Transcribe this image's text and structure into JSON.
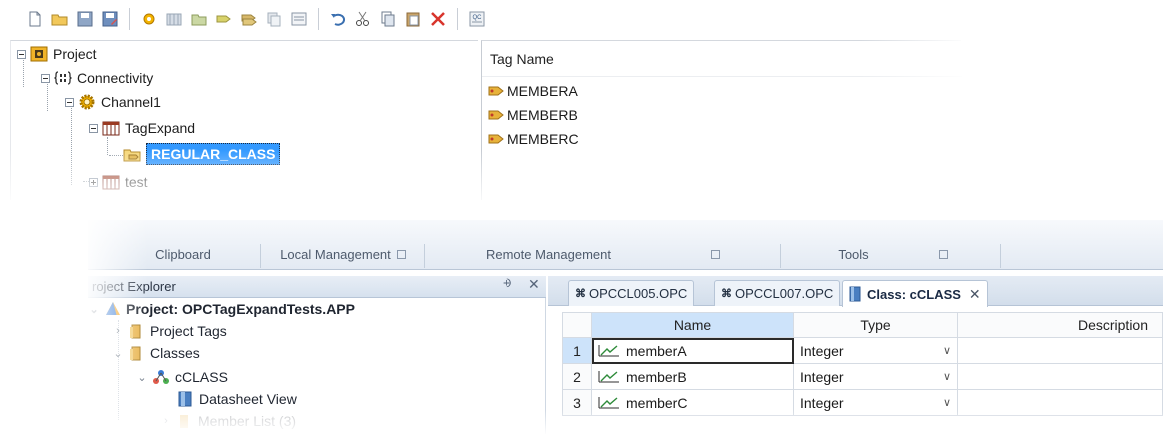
{
  "top": {
    "toolbar": {
      "icons": [
        "new-icon",
        "open-icon",
        "save-icon",
        "save-as-icon",
        "new-channel-icon",
        "new-device-icon",
        "new-group-icon",
        "new-tag-icon",
        "bulk-tag-icon",
        "duplicate-icon",
        "properties-icon",
        "undo-icon",
        "cut-icon",
        "copy-icon",
        "paste-icon",
        "delete-icon",
        "quick-client-icon"
      ]
    },
    "tree": {
      "project": "Project",
      "connectivity": "Connectivity",
      "channel": "Channel1",
      "device": "TagExpand",
      "group": "REGULAR_CLASS",
      "device2": "test"
    },
    "tags": {
      "header": "Tag Name",
      "rows": [
        "MEMBERA",
        "MEMBERB",
        "MEMBERC"
      ]
    }
  },
  "bottom": {
    "ribbon": {
      "groups": [
        "Clipboard",
        "Local Management",
        "Remote Management",
        "Tools"
      ]
    },
    "explorer": {
      "title": "roject Explorer",
      "pin": "⨮",
      "close": "✕",
      "project": "Project: OPCTagExpandTests.APP",
      "project_tags": "Project Tags",
      "classes": "Classes",
      "class": "cCLASS",
      "datasheet": "Datasheet View",
      "member_list": "Member List (3)"
    },
    "tabs": [
      {
        "label": "OPCCL005.OPC",
        "active": false
      },
      {
        "label": "OPCCL007.OPC",
        "active": false
      },
      {
        "label": "Class: cCLASS",
        "active": true,
        "close": "✕"
      }
    ],
    "grid": {
      "columns": [
        "Name",
        "Type",
        "Description"
      ],
      "rows": [
        {
          "num": "1",
          "name": "memberA",
          "type": "Integer",
          "description": ""
        },
        {
          "num": "2",
          "name": "memberB",
          "type": "Integer",
          "description": ""
        },
        {
          "num": "3",
          "name": "memberC",
          "type": "Integer",
          "description": ""
        }
      ]
    }
  },
  "colors": {
    "selection": "#3399ff",
    "ribbon_label": "#4d5a6c",
    "header_selected": "#cde3fa"
  }
}
